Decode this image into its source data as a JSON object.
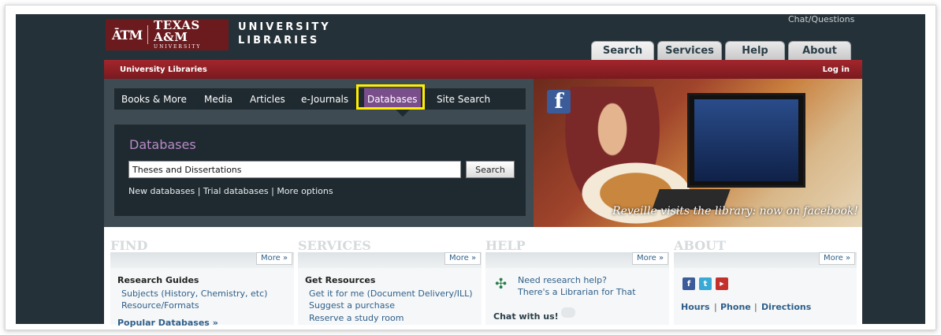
{
  "header": {
    "logo_atm": "ĀTM",
    "logo_name": "TEXAS A&M",
    "logo_sub": "UNIVERSITY",
    "unilib_line1": "UNIVERSITY",
    "unilib_line2": "LIBRARIES",
    "chat_questions": "Chat/Questions",
    "tabs": [
      {
        "label": "Search"
      },
      {
        "label": "Services"
      },
      {
        "label": "Help"
      },
      {
        "label": "About"
      }
    ]
  },
  "redbar": {
    "left": "University Libraries",
    "right": "Log in"
  },
  "nav": {
    "items": [
      {
        "label": "Books & More"
      },
      {
        "label": "Media"
      },
      {
        "label": "Articles"
      },
      {
        "label": "e-Journals"
      },
      {
        "label": "Databases"
      },
      {
        "label": "Site Search"
      }
    ],
    "active": "Databases"
  },
  "databases": {
    "title": "Databases",
    "input_value": "Theses and Dissertations",
    "search_label": "Search",
    "links": "New databases | Trial databases | More options"
  },
  "promo": {
    "fb_letter": "f",
    "caption": "Reveille visits the library: now on facebook!"
  },
  "columns": {
    "more_label": "More »",
    "find": {
      "head": "FIND",
      "section": "Research Guides",
      "link1": "Subjects (History, Chemistry, etc)",
      "link2": "Resource/Formats",
      "cut": "Popular Databases »"
    },
    "services": {
      "head": "SERVICES",
      "section": "Get Resources",
      "link1": "Get it for me (Document Delivery/ILL)",
      "link2": "Suggest a purchase",
      "link3": "Reserve a study room"
    },
    "help": {
      "head": "HELP",
      "link1": "Need research help?",
      "link2": "There's a Librarian for That",
      "chat": "Chat with us!"
    },
    "about": {
      "head": "ABOUT",
      "hours": "Hours",
      "phone": "Phone",
      "directions": "Directions",
      "sep": "|"
    }
  },
  "colors": {
    "maroon": "#7a1a1f",
    "highlight": "#ffee00",
    "active_nav": "#7a4e8a",
    "dark_bg": "#253138"
  }
}
